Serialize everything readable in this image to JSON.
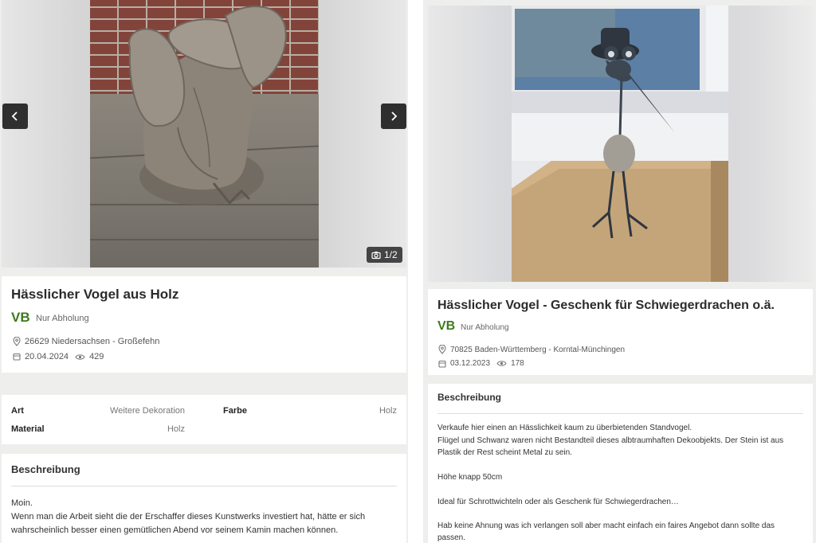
{
  "left": {
    "gallery": {
      "counter": "1/2"
    },
    "listing": {
      "title": "Hässlicher Vogel aus Holz",
      "price": "VB",
      "shipping": "Nur Abholung",
      "location": "26629 Niedersachsen - Großefehn",
      "date": "20.04.2024",
      "views": "429"
    },
    "attributes": [
      {
        "key": "Art",
        "value": "Weitere Dekoration"
      },
      {
        "key": "Farbe",
        "value": "Holz"
      },
      {
        "key": "Material",
        "value": "Holz"
      }
    ],
    "description": {
      "heading": "Beschreibung",
      "lines": [
        "Moin.",
        "Wenn man die Arbeit sieht die der Erschaffer dieses Kunstwerks investiert hat, hätte er sich",
        "wahrscheinlich besser einen gemütlichen Abend vor seinem Kamin machen können."
      ]
    }
  },
  "right": {
    "listing": {
      "title": "Hässlicher Vogel - Geschenk für Schwiegerdrachen o.ä.",
      "price": "VB",
      "shipping": "Nur Abholung",
      "location": "70825 Baden-Württemberg - Korntal-Münchingen",
      "date": "03.12.2023",
      "views": "178"
    },
    "description": {
      "heading": "Beschreibung",
      "lines": [
        "Verkaufe hier einen an Hässlichkeit kaum zu überbietenden Standvogel.",
        "Flügel und Schwanz waren nicht Bestandteil dieses albtraumhaften Dekoobjekts. Der Stein ist aus",
        "Plastik der Rest scheint Metal zu sein.",
        "Höhe knapp 50cm",
        "Ideal für Schrottwichteln oder als Geschenk für Schwiegerdrachen…",
        "Hab keine Ahnung was ich verlangen soll aber macht einfach ein faires Angebot dann sollte das",
        "passen."
      ]
    }
  },
  "icons": {
    "prev": "chevron-left-icon",
    "next": "chevron-right-icon",
    "camera": "camera-icon",
    "location": "location-pin-icon",
    "calendar": "calendar-icon",
    "views": "eye-icon"
  },
  "colors": {
    "price": "#3d7a1d",
    "nav_button": "#2f2f2f",
    "panel_bg": "#eeeeec"
  }
}
